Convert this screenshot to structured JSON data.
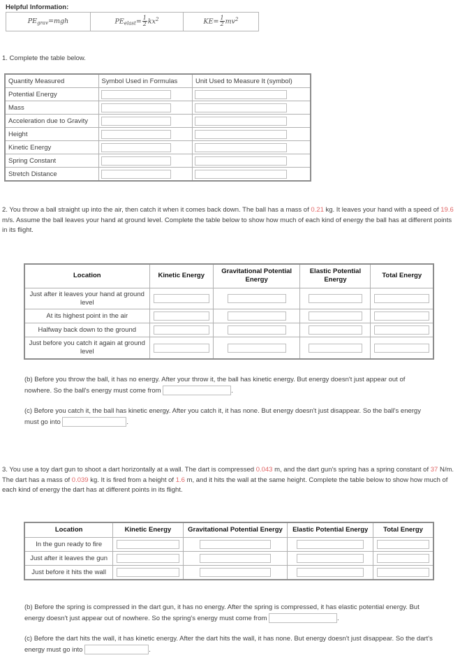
{
  "helpful": {
    "title": "Helpful Information:",
    "formulas": [
      {
        "name": "pe-grav-formula",
        "lhs": "PE",
        "subscript": "grav",
        "eq": "=mgh"
      },
      {
        "name": "pe-elast-formula",
        "lhs": "PE",
        "subscript": "elast",
        "eq": "=",
        "frac_num": "1",
        "frac_den": "2",
        "tail": "kx",
        "tail_sup": "2"
      },
      {
        "name": "ke-formula",
        "lhs": "KE",
        "subscript": "",
        "eq": "=",
        "frac_num": "1",
        "frac_den": "2",
        "tail": "mv",
        "tail_sup": "2"
      }
    ]
  },
  "question1": {
    "prompt": "1. Complete the table below.",
    "table": {
      "headers": [
        "Quantity Measured",
        "Symbol Used in Formulas",
        "Unit Used to Measure It (symbol)"
      ],
      "rows": [
        "Potential Energy",
        "Mass",
        "Acceleration due to Gravity",
        "Height",
        "Kinetic Energy",
        "Spring Constant",
        "Stretch Distance"
      ]
    }
  },
  "question2": {
    "prompt_part1": "2. You throw a ball straight up into the air, then catch it when it comes back down. The ball has a mass of ",
    "mass_value": "0.21",
    "prompt_part2": " kg. It leaves your hand with a speed of ",
    "speed_value": "19.6",
    "prompt_part3": " m/s. Assume the ball leaves your hand at ground level. Complete the table below to show how much of each kind of energy the ball has at different points in its flight.",
    "table": {
      "headers": [
        "Location",
        "Kinetic Energy",
        "Gravitational Potential Energy",
        "Elastic Potential Energy",
        "Total Energy"
      ],
      "rows": [
        "Just after it leaves your hand at ground level",
        "At its highest point in the air",
        "Halfway back down to the ground",
        "Just before you catch it again at ground level"
      ]
    },
    "part_b_pre": "(b) Before you throw the ball, it has no energy. After your throw it, the ball has kinetic energy. But energy doesn't just appear out of nowhere. So the ball's energy must come from ",
    "part_b_post": ".",
    "part_c_pre": "(c) Before you catch it, the ball has kinetic energy. After you catch it, it has none. But energy doesn't just disappear. So the ball's energy must go into ",
    "part_c_post": "."
  },
  "question3": {
    "prompt_part1": "3. You use a toy dart gun to shoot a dart horizontally at a wall. The dart is compressed ",
    "compression_value": "0.043",
    "prompt_part2": " m, and the dart gun's spring has a spring constant of ",
    "spring_constant_value": "37",
    "prompt_part3": " N/m. The dart has a mass of ",
    "mass_value": "0.039",
    "prompt_part4": " kg. It is fired from a height of ",
    "height_value": "1.6",
    "prompt_part5": " m, and it hits the wall at the same height. Complete the table below to show how much of each kind of energy the dart has at different points in its flight.",
    "table": {
      "headers": [
        "Location",
        "Kinetic Energy",
        "Gravitational Potential Energy",
        "Elastic Potential Energy",
        "Total Energy"
      ],
      "rows": [
        "In the gun ready to fire",
        "Just after it leaves the gun",
        "Just before it hits the wall"
      ]
    },
    "part_b_pre": "(b) Before the spring is compressed in the dart gun, it has no energy. After the spring is compressed, it has elastic potential energy. But energy doesn't just appear out of nowhere. So the spring's energy must come from ",
    "part_b_post": ".",
    "part_c_pre": "(c) Before the dart hits the wall, it has kinetic energy. After the dart hits the wall, it has none. But energy doesn't just disappear. So the dart's energy must go into ",
    "part_c_post": "."
  },
  "colors": {
    "highlight": "#e06666",
    "text": "#3d3d3d",
    "border": "#b0b0b0",
    "outer_border": "#8c8c8c"
  }
}
